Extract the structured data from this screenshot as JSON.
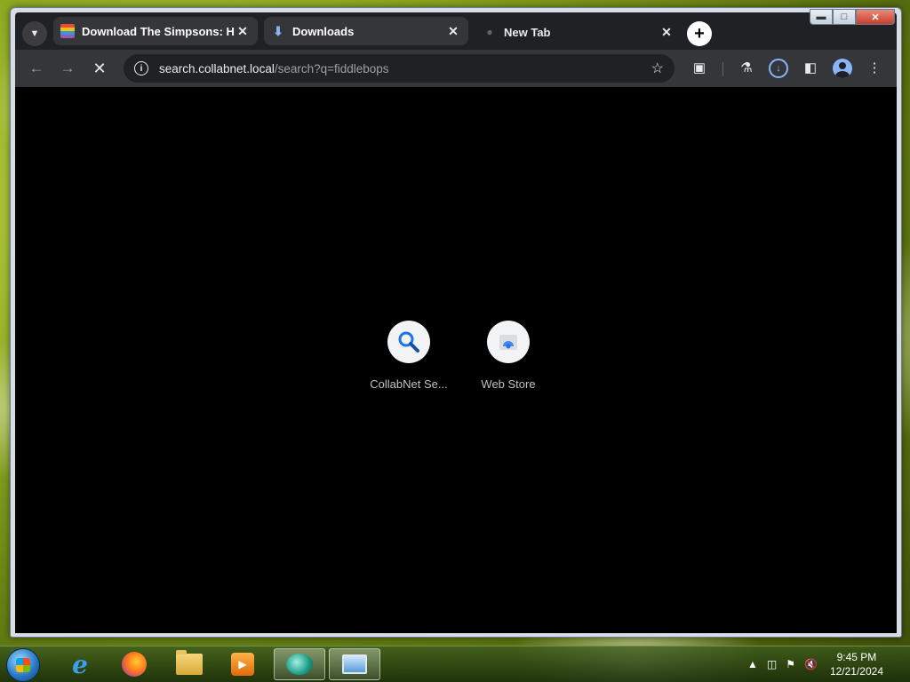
{
  "browser": {
    "tabs": [
      {
        "title": "Download The Simpsons: Hit &",
        "icon": "simpsons-favicon"
      },
      {
        "title": "Downloads",
        "icon": "download-icon"
      },
      {
        "title": "New Tab",
        "icon": "new-tab-favicon"
      }
    ],
    "address_bar": {
      "domain": "search.collabnet.local",
      "path": "/search?q=fiddlebops"
    },
    "window_controls": [
      "minimize",
      "maximize",
      "close"
    ]
  },
  "new_tab_page": {
    "shortcuts": [
      {
        "label": "CollabNet Se...",
        "icon": "search-icon"
      },
      {
        "label": "Web Store",
        "icon": "web-store-icon"
      }
    ]
  },
  "taskbar": {
    "apps": [
      "internet-explorer",
      "firefox",
      "file-explorer",
      "media-player",
      "chat-app",
      "remote-desktop"
    ],
    "clock_time": "9:45 PM",
    "clock_date": "12/21/2024"
  },
  "colors": {
    "page_bg": "#000000",
    "toolbar": "#35363a",
    "titlebar": "#202124",
    "accent": "#8ab4f8"
  }
}
